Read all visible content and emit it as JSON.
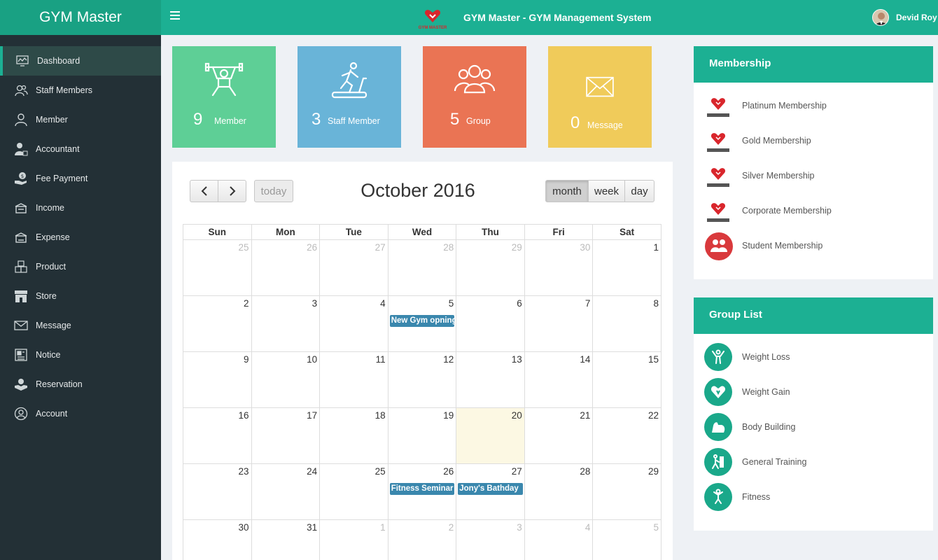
{
  "app": {
    "brand": "GYM Master",
    "title": "GYM Master - GYM Management System",
    "logo_text": "GYM MASTER",
    "user": "Devid Roy",
    "accent": "#1cb093"
  },
  "sidebar": {
    "items": [
      {
        "label": "Dashboard",
        "icon": "dashboard-icon",
        "active": true
      },
      {
        "label": "Staff Members",
        "icon": "staff-icon"
      },
      {
        "label": "Member",
        "icon": "member-icon"
      },
      {
        "label": "Accountant",
        "icon": "accountant-icon"
      },
      {
        "label": "Fee Payment",
        "icon": "fee-payment-icon"
      },
      {
        "label": "Income",
        "icon": "income-icon"
      },
      {
        "label": "Expense",
        "icon": "expense-icon"
      },
      {
        "label": "Product",
        "icon": "product-icon"
      },
      {
        "label": "Store",
        "icon": "store-icon"
      },
      {
        "label": "Message",
        "icon": "message-icon"
      },
      {
        "label": "Notice",
        "icon": "notice-icon"
      },
      {
        "label": "Reservation",
        "icon": "reservation-icon"
      },
      {
        "label": "Account",
        "icon": "account-icon"
      }
    ]
  },
  "stats": [
    {
      "count": "9",
      "label": "Member",
      "color": "#5ecf96"
    },
    {
      "count": "3",
      "label": "Staff Member",
      "color": "#69b4d8"
    },
    {
      "count": "5",
      "label": "Group",
      "color": "#ea7454"
    },
    {
      "count": "0",
      "label": "Message",
      "color": "#f0cb5a"
    }
  ],
  "calendar": {
    "title": "October 2016",
    "today_label": "today",
    "views": [
      "month",
      "week",
      "day"
    ],
    "active_view": "month",
    "weekdays": [
      "Sun",
      "Mon",
      "Tue",
      "Wed",
      "Thu",
      "Fri",
      "Sat"
    ],
    "weeks": [
      [
        {
          "d": "25",
          "o": true
        },
        {
          "d": "26",
          "o": true
        },
        {
          "d": "27",
          "o": true
        },
        {
          "d": "28",
          "o": true
        },
        {
          "d": "29",
          "o": true
        },
        {
          "d": "30",
          "o": true
        },
        {
          "d": "1"
        }
      ],
      [
        {
          "d": "2"
        },
        {
          "d": "3"
        },
        {
          "d": "4"
        },
        {
          "d": "5",
          "event": "New Gym opning"
        },
        {
          "d": "6"
        },
        {
          "d": "7"
        },
        {
          "d": "8"
        }
      ],
      [
        {
          "d": "9"
        },
        {
          "d": "10"
        },
        {
          "d": "11"
        },
        {
          "d": "12"
        },
        {
          "d": "13"
        },
        {
          "d": "14"
        },
        {
          "d": "15"
        }
      ],
      [
        {
          "d": "16"
        },
        {
          "d": "17"
        },
        {
          "d": "18"
        },
        {
          "d": "19"
        },
        {
          "d": "20",
          "today": true
        },
        {
          "d": "21"
        },
        {
          "d": "22"
        }
      ],
      [
        {
          "d": "23"
        },
        {
          "d": "24"
        },
        {
          "d": "25"
        },
        {
          "d": "26",
          "event": "Fitness Seminar"
        },
        {
          "d": "27",
          "event": "Jony's Bathday"
        },
        {
          "d": "28"
        },
        {
          "d": "29"
        }
      ],
      [
        {
          "d": "30"
        },
        {
          "d": "31"
        },
        {
          "d": "1",
          "o": true
        },
        {
          "d": "2",
          "o": true
        },
        {
          "d": "3",
          "o": true
        },
        {
          "d": "4",
          "o": true
        },
        {
          "d": "5",
          "o": true
        }
      ]
    ]
  },
  "membership": {
    "title": "Membership",
    "items": [
      {
        "label": "Platinum Membership",
        "icon": "gym-master-logo-icon"
      },
      {
        "label": "Gold Membership",
        "icon": "gym-master-logo-icon"
      },
      {
        "label": "Silver Membership",
        "icon": "gym-master-logo-icon"
      },
      {
        "label": "Corporate Membership",
        "icon": "gym-master-logo-icon"
      },
      {
        "label": "Student Membership",
        "icon": "people-icon"
      }
    ]
  },
  "groups": {
    "title": "Group List",
    "items": [
      {
        "label": "Weight Loss",
        "icon": "weight-loss-icon"
      },
      {
        "label": "Weight Gain",
        "icon": "weight-gain-icon"
      },
      {
        "label": "Body Building",
        "icon": "body-building-icon"
      },
      {
        "label": "General Training",
        "icon": "general-training-icon"
      },
      {
        "label": "Fitness",
        "icon": "fitness-icon"
      }
    ]
  }
}
